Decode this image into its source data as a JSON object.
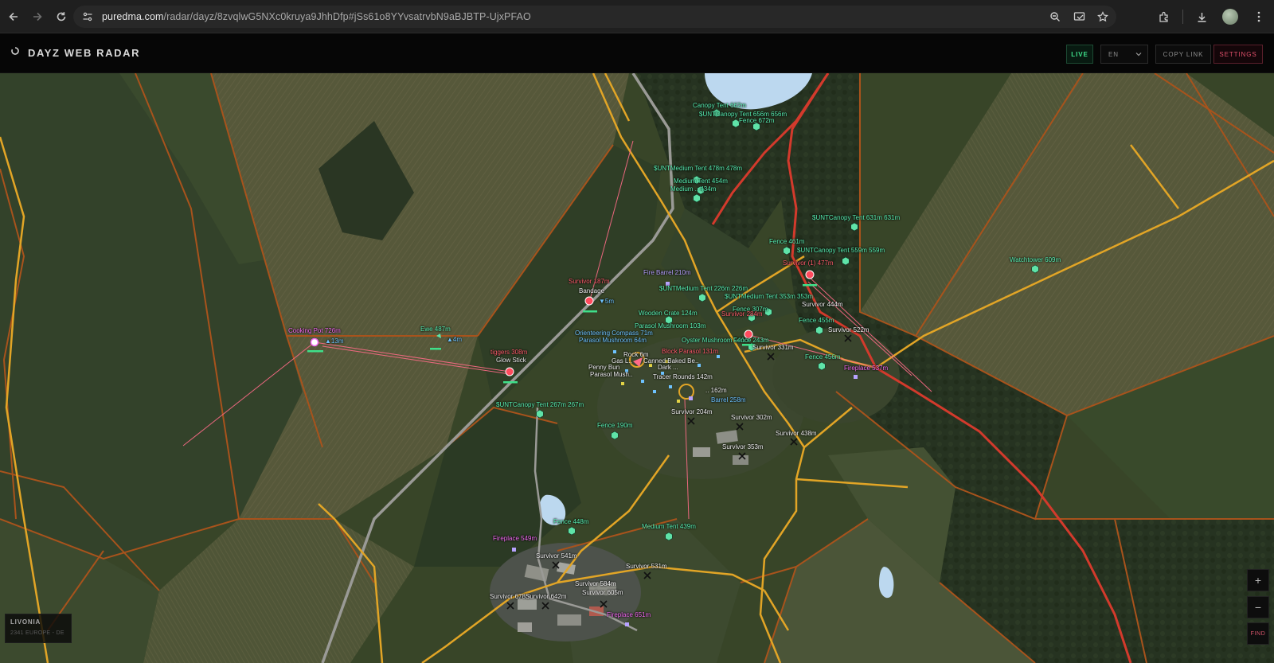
{
  "browser": {
    "url_host": "puredma.com",
    "url_path": "/radar/dayz/8zvqlwG5NXc0kruya9JhhDfp#jSs61o8YYvsatrvbN9aBJBTP-UjxPFAO"
  },
  "header": {
    "title": "DAYZ WEB RADAR",
    "live_label": "LIVE",
    "language": "EN",
    "copy_link_label": "COPY LINK",
    "settings_label": "SETTINGS"
  },
  "map_info": {
    "map_name": "LIVONIA",
    "server": "2341 EUROPE - DE"
  },
  "controls": {
    "zoom_in": "+",
    "zoom_out": "−",
    "find": "FIND"
  },
  "colors": {
    "road": "#e2a526",
    "main_road": "#d33a2c",
    "field_border": "#b4561e",
    "loot_marker": "#5fe3a8",
    "player_marker": "#ff4b5e",
    "sight_line": "#ff6b88",
    "live": "#3fe08a",
    "settings": "#e0506a"
  },
  "markers": [
    {
      "id": "m1",
      "kind": "loot",
      "label": "Canopy Tent  662m"
    },
    {
      "id": "m2",
      "kind": "loot",
      "label": "$UNTCanopy Tent 656m 656m"
    },
    {
      "id": "m3",
      "kind": "loot",
      "label": "Fence  672m"
    },
    {
      "id": "m4",
      "kind": "loot",
      "label": "$UNTMedium Tent 478m 478m"
    },
    {
      "id": "m5",
      "kind": "loot",
      "label": "Medium Tent  454m"
    },
    {
      "id": "m6",
      "kind": "loot",
      "label": "Medium ..  434m"
    },
    {
      "id": "m7",
      "kind": "loot",
      "label": "$UNTCanopy Tent 631m 631m"
    },
    {
      "id": "m8",
      "kind": "loot",
      "label": "Fence  461m"
    },
    {
      "id": "m9",
      "kind": "loot",
      "label": "$UNTCanopy Tent 559m 559m"
    },
    {
      "id": "m10",
      "kind": "loot",
      "label": "Watchtower  609m"
    },
    {
      "id": "m11",
      "kind": "player",
      "label": "Survivor (1)  477m"
    },
    {
      "id": "m12",
      "kind": "player",
      "label": "Survivor  187m"
    },
    {
      "id": "m12b",
      "kind": "item",
      "label": "Bandage"
    },
    {
      "id": "m12c",
      "kind": "distance",
      "label": "▼5m"
    },
    {
      "id": "m13",
      "kind": "item-magenta",
      "label": "Fire Barrel  210m"
    },
    {
      "id": "m14",
      "kind": "loot",
      "label": "$UNTMedium Tent 226m 226m"
    },
    {
      "id": "m15",
      "kind": "loot",
      "label": "$UNTMedium Tent 353m 353m"
    },
    {
      "id": "m16",
      "kind": "corpse",
      "label": "Survivor  444m"
    },
    {
      "id": "m17",
      "kind": "loot",
      "label": "Fence  307m"
    },
    {
      "id": "m18",
      "kind": "player",
      "label": "Survivor  284m"
    },
    {
      "id": "m19",
      "kind": "loot",
      "label": "Wooden Crate  124m"
    },
    {
      "id": "m20",
      "kind": "loot",
      "label": "Parasol Mushroom  103m"
    },
    {
      "id": "m21",
      "kind": "loot",
      "label": "Oyster Mushroom  141m"
    },
    {
      "id": "m22",
      "kind": "loot",
      "label": "Fence  243m"
    },
    {
      "id": "m23",
      "kind": "loot",
      "label": "Fence  455m"
    },
    {
      "id": "m24",
      "kind": "corpse",
      "label": "Survivor  522m"
    },
    {
      "id": "m25",
      "kind": "corpse",
      "label": "Survivor  331m"
    },
    {
      "id": "m26",
      "kind": "loot",
      "label": "Orienteering Compass  71m"
    },
    {
      "id": "m27",
      "kind": "loot",
      "label": "Parasol Mushroom  64m"
    },
    {
      "id": "m28",
      "kind": "loot",
      "label": "Fence  456m"
    },
    {
      "id": "m29",
      "kind": "item-magenta",
      "label": "Fireplace  537m"
    },
    {
      "id": "m30",
      "kind": "item-magenta",
      "label": "Cooking Pot  726m"
    },
    {
      "id": "m30b",
      "kind": "distance",
      "label": "▲13m"
    },
    {
      "id": "m31",
      "kind": "loot",
      "label": "Ewe  487m"
    },
    {
      "id": "m31b",
      "kind": "distance",
      "label": "▲4m"
    },
    {
      "id": "m32",
      "kind": "player",
      "label": "tiggers  308m"
    },
    {
      "id": "m32b",
      "kind": "item",
      "label": "Glow Stick"
    },
    {
      "id": "m33",
      "kind": "loot",
      "label": "$UNTCanopy Tent 267m 267m"
    },
    {
      "id": "m34",
      "kind": "loot",
      "label": "Barrel  258m"
    },
    {
      "id": "m35",
      "kind": "corpse",
      "label": "Survivor  204m"
    },
    {
      "id": "m36",
      "kind": "corpse",
      "label": "Survivor  302m"
    },
    {
      "id": "m37",
      "kind": "loot",
      "label": "Fence  190m"
    },
    {
      "id": "m38",
      "kind": "corpse",
      "label": "Survivor  438m"
    },
    {
      "id": "m39",
      "kind": "corpse",
      "label": "Survivor  353m"
    },
    {
      "id": "m40",
      "kind": "loot",
      "label": "Fence  448m"
    },
    {
      "id": "m41",
      "kind": "loot",
      "label": "Medium Tent  439m"
    },
    {
      "id": "m42",
      "kind": "item-magenta",
      "label": "Fireplace  549m"
    },
    {
      "id": "m43",
      "kind": "corpse",
      "label": "Survivor  541m"
    },
    {
      "id": "m44",
      "kind": "corpse",
      "label": "Survivor  531m"
    },
    {
      "id": "m45",
      "kind": "corpse",
      "label": "Survivor  584m"
    },
    {
      "id": "m46",
      "kind": "corpse",
      "label": "Survivor  678m"
    },
    {
      "id": "m47",
      "kind": "corpse",
      "label": "Survivor  642m"
    },
    {
      "id": "m48",
      "kind": "corpse",
      "label": "Survivor  605m"
    },
    {
      "id": "m49",
      "kind": "item-magenta",
      "label": "Fireplace  651m"
    },
    {
      "id": "m50",
      "kind": "loot",
      "label": "Rock  6m"
    },
    {
      "id": "m51",
      "kind": "loot",
      "label": "Gas L.."
    },
    {
      "id": "m52",
      "kind": "loot",
      "label": "Penny Bun"
    },
    {
      "id": "m53",
      "kind": "loot",
      "label": "Parasol Mush.."
    },
    {
      "id": "m54",
      "kind": "loot",
      "label": "Canned Baked Be.."
    },
    {
      "id": "m55",
      "kind": "loot",
      "label": "Dark ..."
    },
    {
      "id": "m56",
      "kind": "loot",
      "label": "Tracer Rounds  142m"
    },
    {
      "id": "m57",
      "kind": "loot",
      "label": "Block Parasol  131m"
    },
    {
      "id": "m58",
      "kind": "loot",
      "label": ".. 162m"
    }
  ]
}
